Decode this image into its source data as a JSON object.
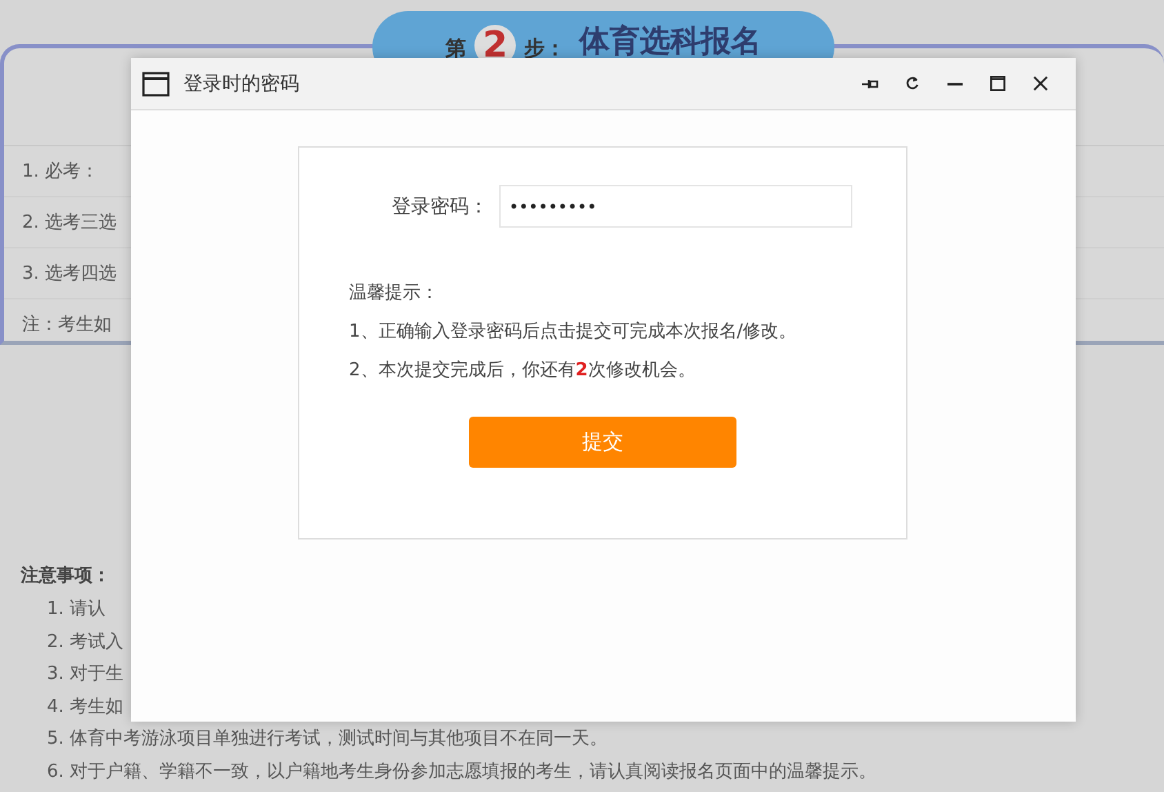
{
  "banner": {
    "prefix": "第",
    "step": "2",
    "suffix": "步：",
    "title": "体育选科报名"
  },
  "subjects": [
    "1. 必考：",
    "2. 选考三选",
    "3. 选考四选",
    "注：考生如"
  ],
  "notes": {
    "heading": "注意事项：",
    "items": [
      "1. 请认",
      "2. 考试入",
      "3. 对于生",
      "4. 考生如",
      "5. 体育中考游泳项目单独进行考试，测试时间与其他项目不在同一天。",
      "6. 对于户籍、学籍不一致，以户籍地考生身份参加志愿填报的考生，请认真阅读报名页面中的温馨提示。"
    ]
  },
  "dialog": {
    "title": "登录时的密码",
    "password_label": "登录密码：",
    "password_value": "•••••••••",
    "tips_heading": "温馨提示：",
    "tips": [
      "1、正确输入登录密码后点击提交可完成本次报名/修改。",
      "2、本次提交完成后，你还有**2**次修改机会。"
    ],
    "submit": "提交"
  }
}
